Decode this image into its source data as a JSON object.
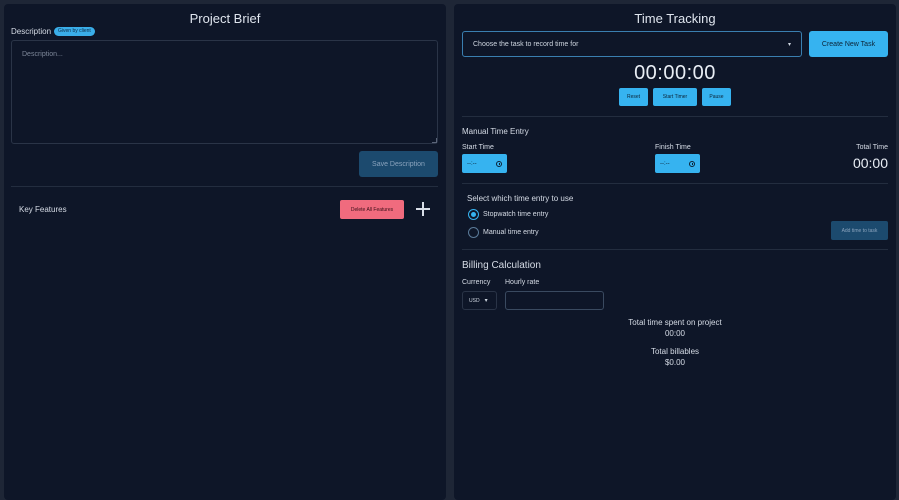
{
  "project_brief": {
    "title": "Project Brief",
    "description_label": "Description",
    "badge": "Given by client",
    "description_placeholder": "Description...",
    "save_label": "Save Description",
    "key_features_label": "Key Features",
    "delete_all_label": "Delete All Features",
    "add_icon": "plus-icon"
  },
  "time_tracking": {
    "title": "Time Tracking",
    "task_select_placeholder": "Choose the task to record time for",
    "create_task_label": "Create New Task",
    "timer": "00:00:00",
    "reset_label": "Reset",
    "start_label": "Start Timer",
    "pause_label": "Pause",
    "manual_entry_label": "Manual Time Entry",
    "start_time_label": "Start Time",
    "finish_time_label": "Finish Time",
    "time_placeholder": "--:--",
    "total_time_label": "Total Time",
    "total_time_value": "00:00",
    "select_entry_label": "Select which time entry to use",
    "stopwatch_option": "Stopwatch time entry",
    "manual_option": "Manual time entry",
    "add_time_label": "Add time to task"
  },
  "billing": {
    "title": "Billing Calculation",
    "currency_label": "Currency",
    "currency_value": "USD",
    "hourly_rate_label": "Hourly rate",
    "total_time_spent_label": "Total time spent on project",
    "total_time_spent_value": "00:00",
    "total_billables_label": "Total billables",
    "total_billables_value": "$0.00"
  },
  "colors": {
    "accent": "#36b3f0",
    "danger": "#f06b7e",
    "panel": "#0e1628",
    "background": "#1e2636"
  }
}
